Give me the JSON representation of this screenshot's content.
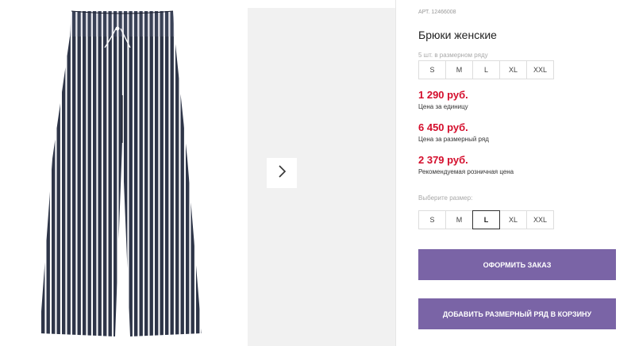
{
  "product": {
    "article": "АРТ. 12466008",
    "title": "Брюки женские",
    "pack_note": "5 шт. в размерном ряду",
    "pack_sizes": [
      "S",
      "M",
      "L",
      "XL",
      "XXL"
    ],
    "prices": [
      {
        "value": "1 290 руб.",
        "label": "Цена за единицу"
      },
      {
        "value": "6 450 руб.",
        "label": "Цена за размерный ряд"
      },
      {
        "value": "2 379 руб.",
        "label": "Рекомендуемая розничная цена"
      }
    ],
    "choose_label": "Выберите размер:",
    "choose_sizes": [
      "S",
      "M",
      "L",
      "XL",
      "XXL"
    ],
    "selected_size": "L"
  },
  "actions": {
    "order_label": "ОФОРМИТЬ ЗАКАЗ",
    "add_pack_label": "ДОБАВИТЬ РАЗМЕРНЫЙ РЯД В КОРЗИНУ"
  },
  "gallery": {
    "next_icon": "chevron-right-icon"
  },
  "colors": {
    "price": "#d40e2c",
    "button": "#7a64a6",
    "pants_base": "#2e3548",
    "pants_stripe": "#ffffff"
  }
}
